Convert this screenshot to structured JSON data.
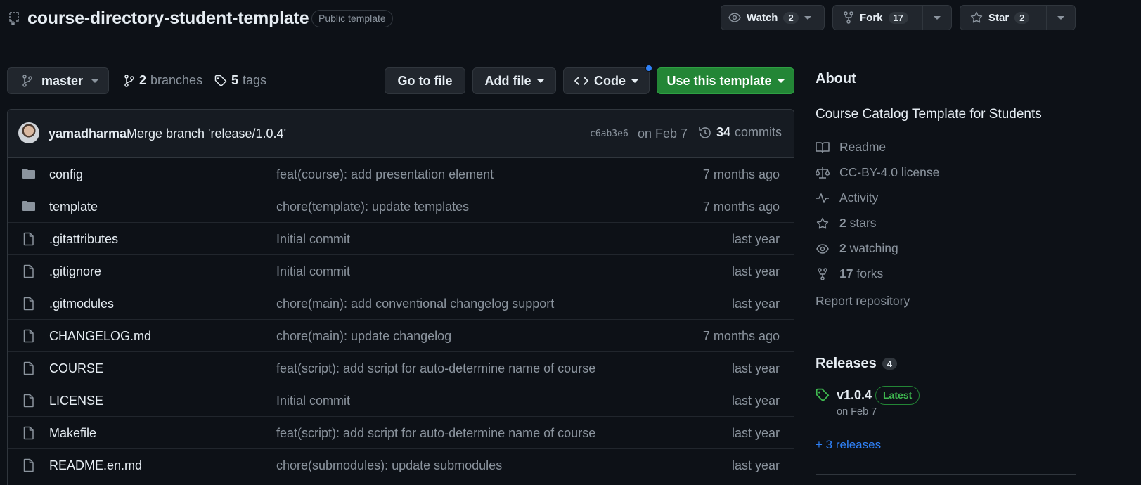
{
  "repo": {
    "name": "course-directory-student-template",
    "visibility": "Public template"
  },
  "header_actions": {
    "watch": {
      "label": "Watch",
      "count": "2"
    },
    "fork": {
      "label": "Fork",
      "count": "17"
    },
    "star": {
      "label": "Star",
      "count": "2"
    }
  },
  "branch_bar": {
    "branch": "master",
    "branches_count": "2",
    "branches_label": "branches",
    "tags_count": "5",
    "tags_label": "tags",
    "go_to_file": "Go to file",
    "add_file": "Add file",
    "code": "Code",
    "use_template": "Use this template"
  },
  "latest_commit": {
    "author": "yamadharma",
    "message": "Merge branch 'release/1.0.4'",
    "sha": "c6ab3e6",
    "date": "on Feb 7",
    "commits_count": "34",
    "commits_label": "commits"
  },
  "files": [
    {
      "type": "dir",
      "name": "config",
      "message": "feat(course): add presentation element",
      "age": "7 months ago"
    },
    {
      "type": "dir",
      "name": "template",
      "message": "chore(template): update templates",
      "age": "7 months ago"
    },
    {
      "type": "file",
      "name": ".gitattributes",
      "message": "Initial commit",
      "age": "last year"
    },
    {
      "type": "file",
      "name": ".gitignore",
      "message": "Initial commit",
      "age": "last year"
    },
    {
      "type": "file",
      "name": ".gitmodules",
      "message": "chore(main): add conventional changelog support",
      "age": "last year"
    },
    {
      "type": "file",
      "name": "CHANGELOG.md",
      "message": "chore(main): update changelog",
      "age": "7 months ago"
    },
    {
      "type": "file",
      "name": "COURSE",
      "message": "feat(script): add script for auto-determine name of course",
      "age": "last year"
    },
    {
      "type": "file",
      "name": "LICENSE",
      "message": "Initial commit",
      "age": "last year"
    },
    {
      "type": "file",
      "name": "Makefile",
      "message": "feat(script): add script for auto-determine name of course",
      "age": "last year"
    },
    {
      "type": "file",
      "name": "README.en.md",
      "message": "chore(submodules): update submodules",
      "age": "last year"
    }
  ],
  "about": {
    "title": "About",
    "description": "Course Catalog Template for Students",
    "readme": "Readme",
    "license": "CC-BY-4.0 license",
    "activity": "Activity",
    "stars_count": "2",
    "stars_label": "stars",
    "watching_count": "2",
    "watching_label": "watching",
    "forks_count": "17",
    "forks_label": "forks",
    "report": "Report repository"
  },
  "releases": {
    "title": "Releases",
    "count": "4",
    "latest_tag": "v1.0.4",
    "latest_badge": "Latest",
    "latest_date": "on Feb 7",
    "more": "+ 3 releases"
  },
  "colors": {
    "background": "#0d1117",
    "border": "#30363d",
    "green_button": "#238636",
    "link_blue": "#2f81f7",
    "muted_text": "#8b949e"
  }
}
